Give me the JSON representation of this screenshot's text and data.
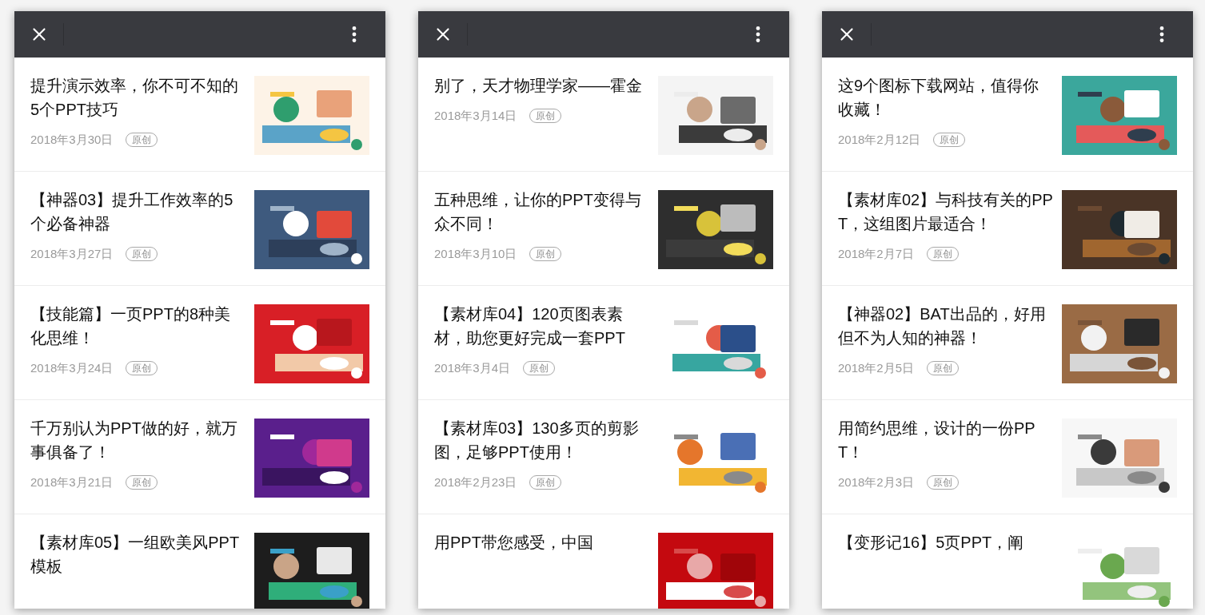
{
  "panels": [
    {
      "articles": [
        {
          "title": "提升演示效率，你不可不知的5个PPT技巧",
          "date": "2018年3月30日",
          "tag": "原创"
        },
        {
          "title": "【神器03】提升工作效率的5个必备神器",
          "date": "2018年3月27日",
          "tag": "原创"
        },
        {
          "title": "【技能篇】一页PPT的8种美化思维！",
          "date": "2018年3月24日",
          "tag": "原创"
        },
        {
          "title": "千万别认为PPT做的好，就万事俱备了！",
          "date": "2018年3月21日",
          "tag": "原创"
        },
        {
          "title": "【素材库05】一组欧美风PPT模板"
        }
      ]
    },
    {
      "articles": [
        {
          "title": "别了，天才物理学家——霍金",
          "date": "2018年3月14日",
          "tag": "原创"
        },
        {
          "title": "五种思维，让你的PPT变得与众不同！",
          "date": "2018年3月10日",
          "tag": "原创"
        },
        {
          "title": "【素材库04】120页图表素材，助您更好完成一套PPT",
          "date": "2018年3月4日",
          "tag": "原创"
        },
        {
          "title": "【素材库03】130多页的剪影图，足够PPT使用！",
          "date": "2018年2月23日",
          "tag": "原创"
        },
        {
          "title": "用PPT带您感受，中国"
        }
      ]
    },
    {
      "articles": [
        {
          "title": "这9个图标下载网站，值得你收藏！",
          "date": "2018年2月12日",
          "tag": "原创"
        },
        {
          "title": "【素材库02】与科技有关的PPT，这组图片最适合！",
          "date": "2018年2月7日",
          "tag": "原创"
        },
        {
          "title": "【神器02】BAT出品的，好用但不为人知的神器！",
          "date": "2018年2月5日",
          "tag": "原创"
        },
        {
          "title": "用简约思维，设计的一份PPT！",
          "date": "2018年2月3日",
          "tag": "原创"
        },
        {
          "title": "【变形记16】5页PPT，阐"
        }
      ]
    }
  ]
}
